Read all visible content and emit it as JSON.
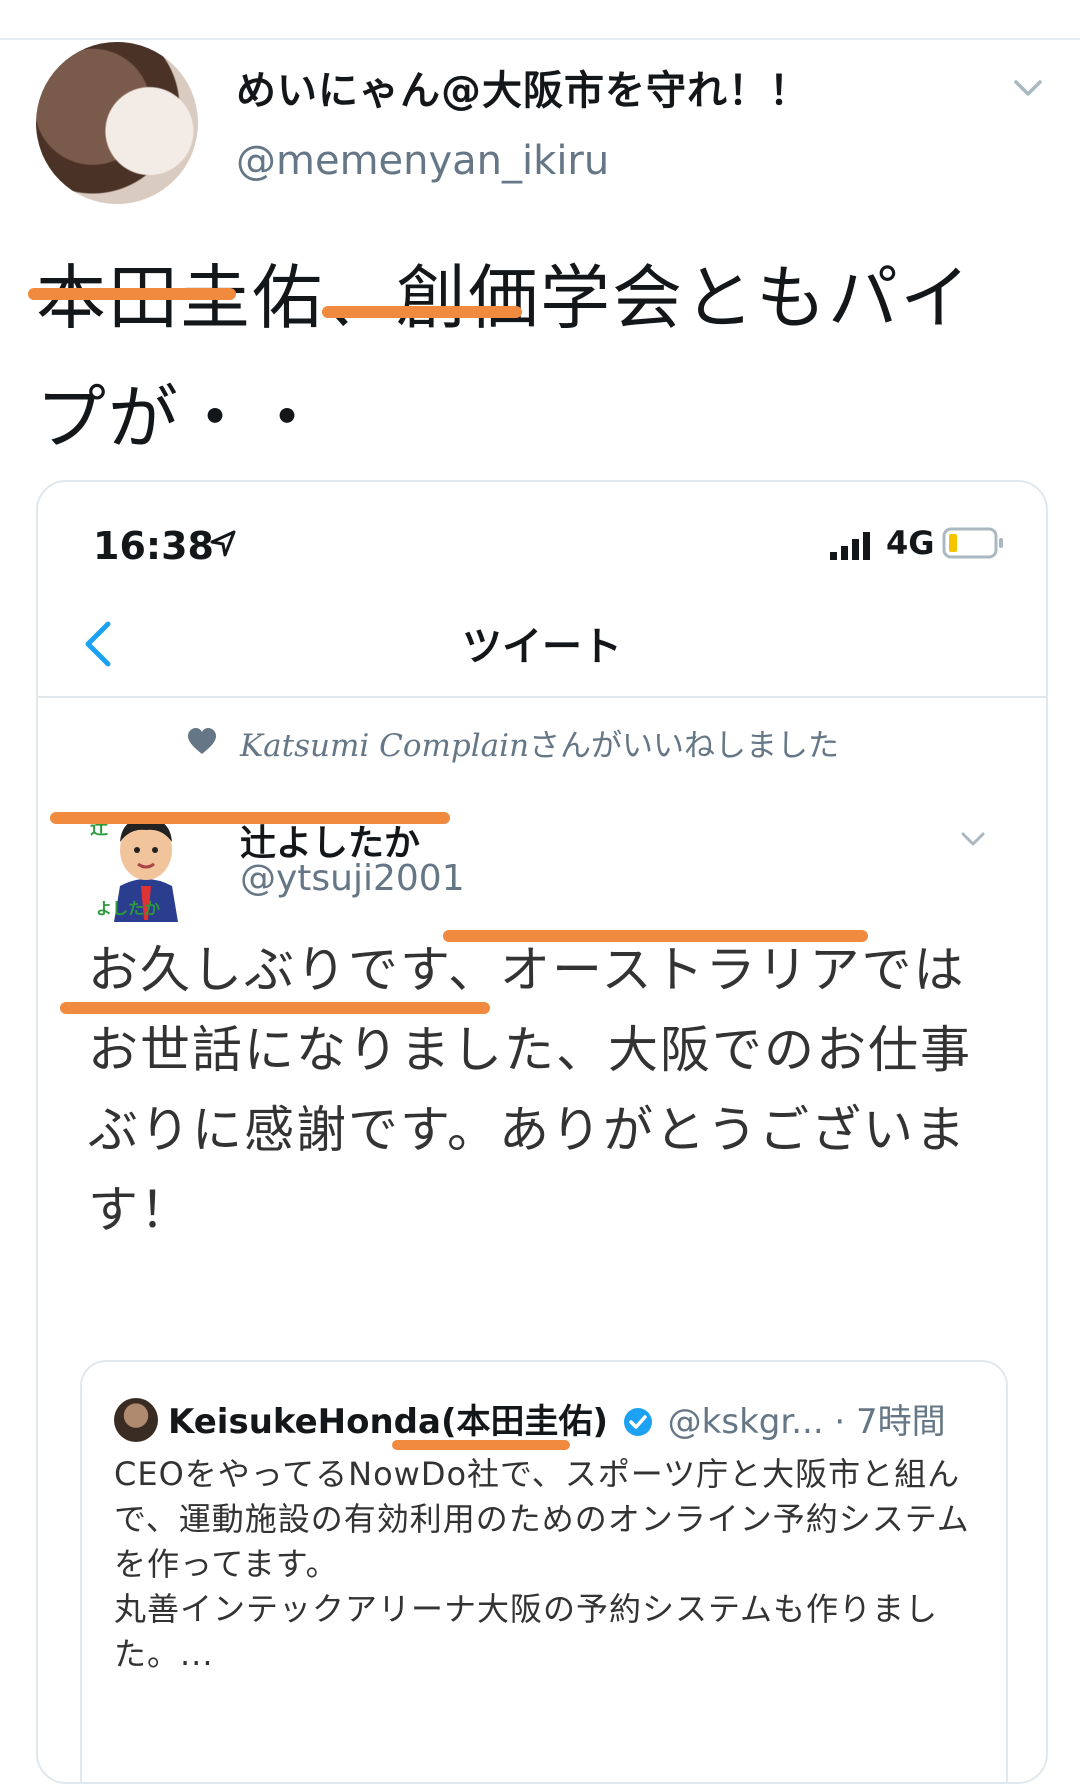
{
  "author": {
    "name": "めいにゃん@大阪市を守れ！！",
    "handle": "@memenyan_ikiru"
  },
  "tweet_text": "本田圭佑、創価学会ともパイプが・・",
  "embedded_screenshot": {
    "status_bar": {
      "time": "16:38",
      "network": "4G"
    },
    "nav_title": "ツイート",
    "liked_by": {
      "name": "Katsumi Complain",
      "suffix": "さんがいいねしました"
    },
    "inner_tweet": {
      "name": "辻よしたか",
      "handle": "@ytsuji2001",
      "text": "お久しぶりです、オーストラリアではお世話になりました、大阪でのお仕事ぶりに感謝です。ありがとうございます！"
    },
    "quoted_tweet": {
      "name": "KeisukeHonda(本田圭佑)",
      "meta": "@kskgr... · 7時間",
      "text": "CEOをやってるNowDo社で、スポーツ庁と大阪市と組んで、運動施設の有効利用のためのオンライン予約システムを作ってます。\n丸善インテックアリーナ大阪の予約システムも作りました。..."
    }
  },
  "colors": {
    "highlight": "#ef8a3f",
    "link": "#1da1f2",
    "muted": "#657786"
  }
}
